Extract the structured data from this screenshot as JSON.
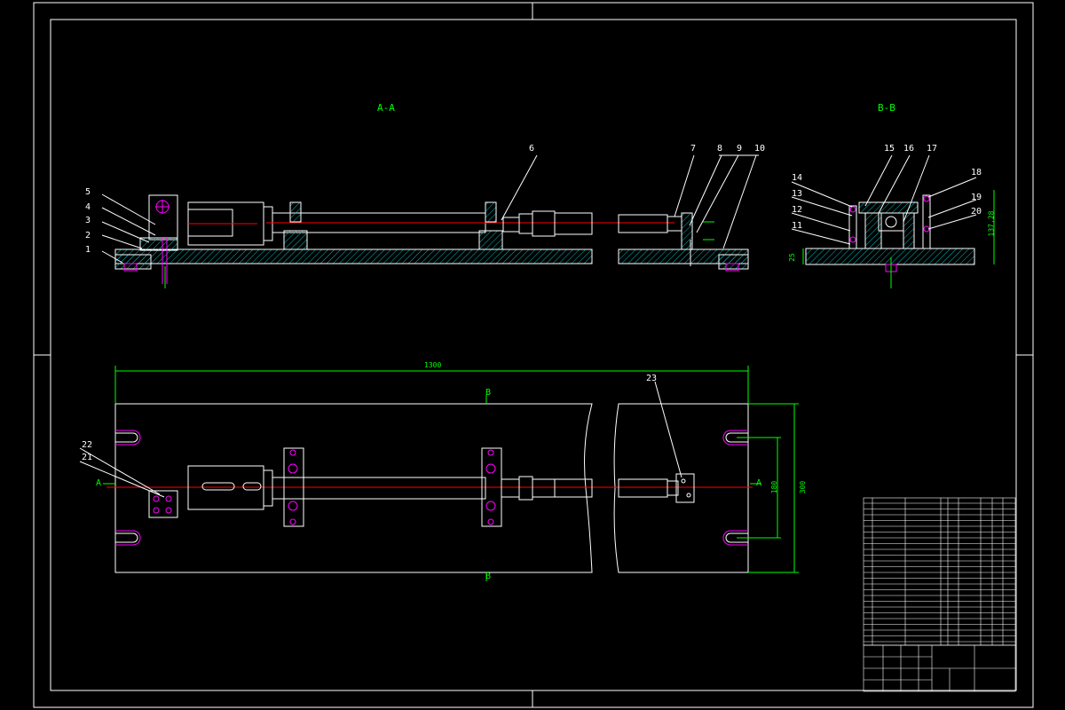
{
  "views": {
    "section_aa": "A-A",
    "section_bb": "B-B"
  },
  "part_numbers": [
    "1",
    "2",
    "3",
    "4",
    "5",
    "6",
    "7",
    "8",
    "9",
    "10",
    "11",
    "12",
    "13",
    "14",
    "15",
    "16",
    "17",
    "18",
    "19",
    "20",
    "21",
    "22",
    "23"
  ],
  "dimensions": {
    "overall_length": "1300",
    "width_outer": "300",
    "width_inner": "180",
    "height": "137.28",
    "base_thickness": "25"
  },
  "section_markers": {
    "a": "A",
    "b": "B"
  },
  "colors": {
    "background": "#000000",
    "outline": "#ffffff",
    "hatch": "#00cccc",
    "centerline": "#ff0000",
    "dimension": "#00ff00",
    "highlight": "#ff00ff"
  }
}
